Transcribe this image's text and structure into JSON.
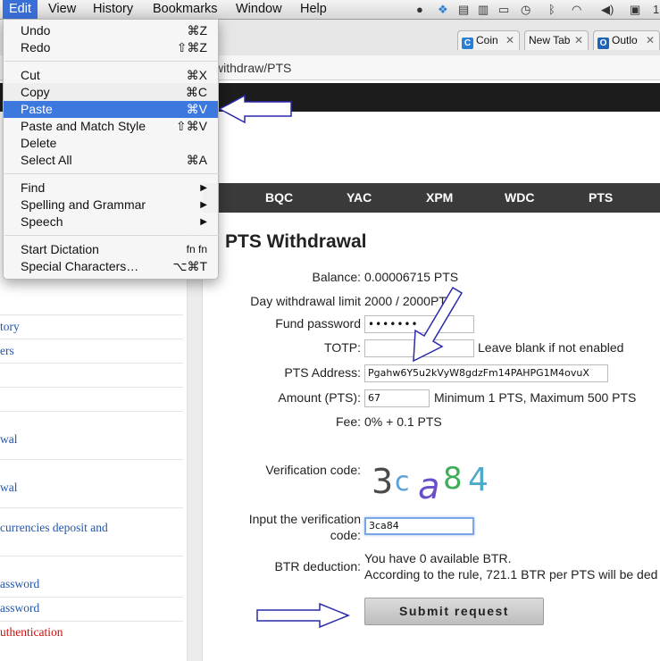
{
  "menubar": {
    "items": [
      "Edit",
      "View",
      "History",
      "Bookmarks",
      "Window",
      "Help"
    ],
    "clock_fragment": "1"
  },
  "tabs": [
    {
      "label": "Coin",
      "favicon": "C",
      "color": "#2a7fd4"
    },
    {
      "label": "New Tab",
      "favicon": "",
      "color": ""
    },
    {
      "label": "Outlo",
      "favicon": "O",
      "color": "#1b64b8"
    }
  ],
  "address": {
    "url_visible": "withdraw/PTS"
  },
  "edit_menu": {
    "groups": [
      [
        {
          "label": "Undo",
          "shortcut": "⌘Z"
        },
        {
          "label": "Redo",
          "shortcut": "⇧⌘Z"
        }
      ],
      [
        {
          "label": "Cut",
          "shortcut": "⌘X"
        },
        {
          "label": "Copy",
          "shortcut": "⌘C"
        },
        {
          "label": "Paste",
          "shortcut": "⌘V",
          "highlighted": true
        },
        {
          "label": "Paste and Match Style",
          "shortcut": "⇧⌘V"
        },
        {
          "label": "Delete",
          "shortcut": ""
        },
        {
          "label": "Select All",
          "shortcut": "⌘A"
        }
      ],
      [
        {
          "label": "Find",
          "shortcut": "▶"
        },
        {
          "label": "Spelling and Grammar",
          "shortcut": "▶"
        },
        {
          "label": "Speech",
          "shortcut": "▶"
        }
      ],
      [
        {
          "label": "Start Dictation",
          "shortcut": "fn fn"
        },
        {
          "label": "Special Characters…",
          "shortcut": "⌥⌘T"
        }
      ]
    ]
  },
  "coin_nav": [
    "BQC",
    "YAC",
    "XPM",
    "WDC",
    "PTS"
  ],
  "sidebar_links": [
    {
      "label": "tory",
      "red": false
    },
    {
      "label": "ers",
      "red": false
    },
    {
      "label": "wal",
      "red": false
    },
    {
      "label": "wal",
      "red": false
    },
    {
      "label": "currencies deposit and",
      "red": false
    },
    {
      "label": "assword",
      "red": false
    },
    {
      "label": "assword",
      "red": false
    },
    {
      "label": "uthentication",
      "red": true
    }
  ],
  "form": {
    "title": "PTS Withdrawal",
    "balance_label": "Balance:",
    "balance_value": "0.00006715 PTS",
    "limit_label": "Day withdrawal limit",
    "limit_value": "2000 / 2000PTS",
    "fund_password_label": "Fund password",
    "fund_password_value": "•••••••",
    "totp_label": "TOTP:",
    "totp_hint": "Leave blank if not enabled",
    "address_label": "PTS Address:",
    "address_value": "Pgahw6Y5u2kVyW8gdzFm14PAHPG1M4ovuX",
    "amount_label": "Amount (PTS):",
    "amount_value": "67",
    "amount_hint": "Minimum 1 PTS, Maximum 500 PTS",
    "fee_label": "Fee:",
    "fee_value": "0% + 0.1 PTS",
    "verification_label": "Verification code:",
    "captcha_text": "3ca84",
    "input_verification_label_1": "Input the verification",
    "input_verification_label_2": "code:",
    "input_verification_value": "3ca84",
    "btr_label": "BTR deduction:",
    "btr_line1": "You have 0 available BTR.",
    "btr_line2": "According to the rule, 721.1 BTR per PTS will be ded",
    "submit_label": "Submit request"
  }
}
